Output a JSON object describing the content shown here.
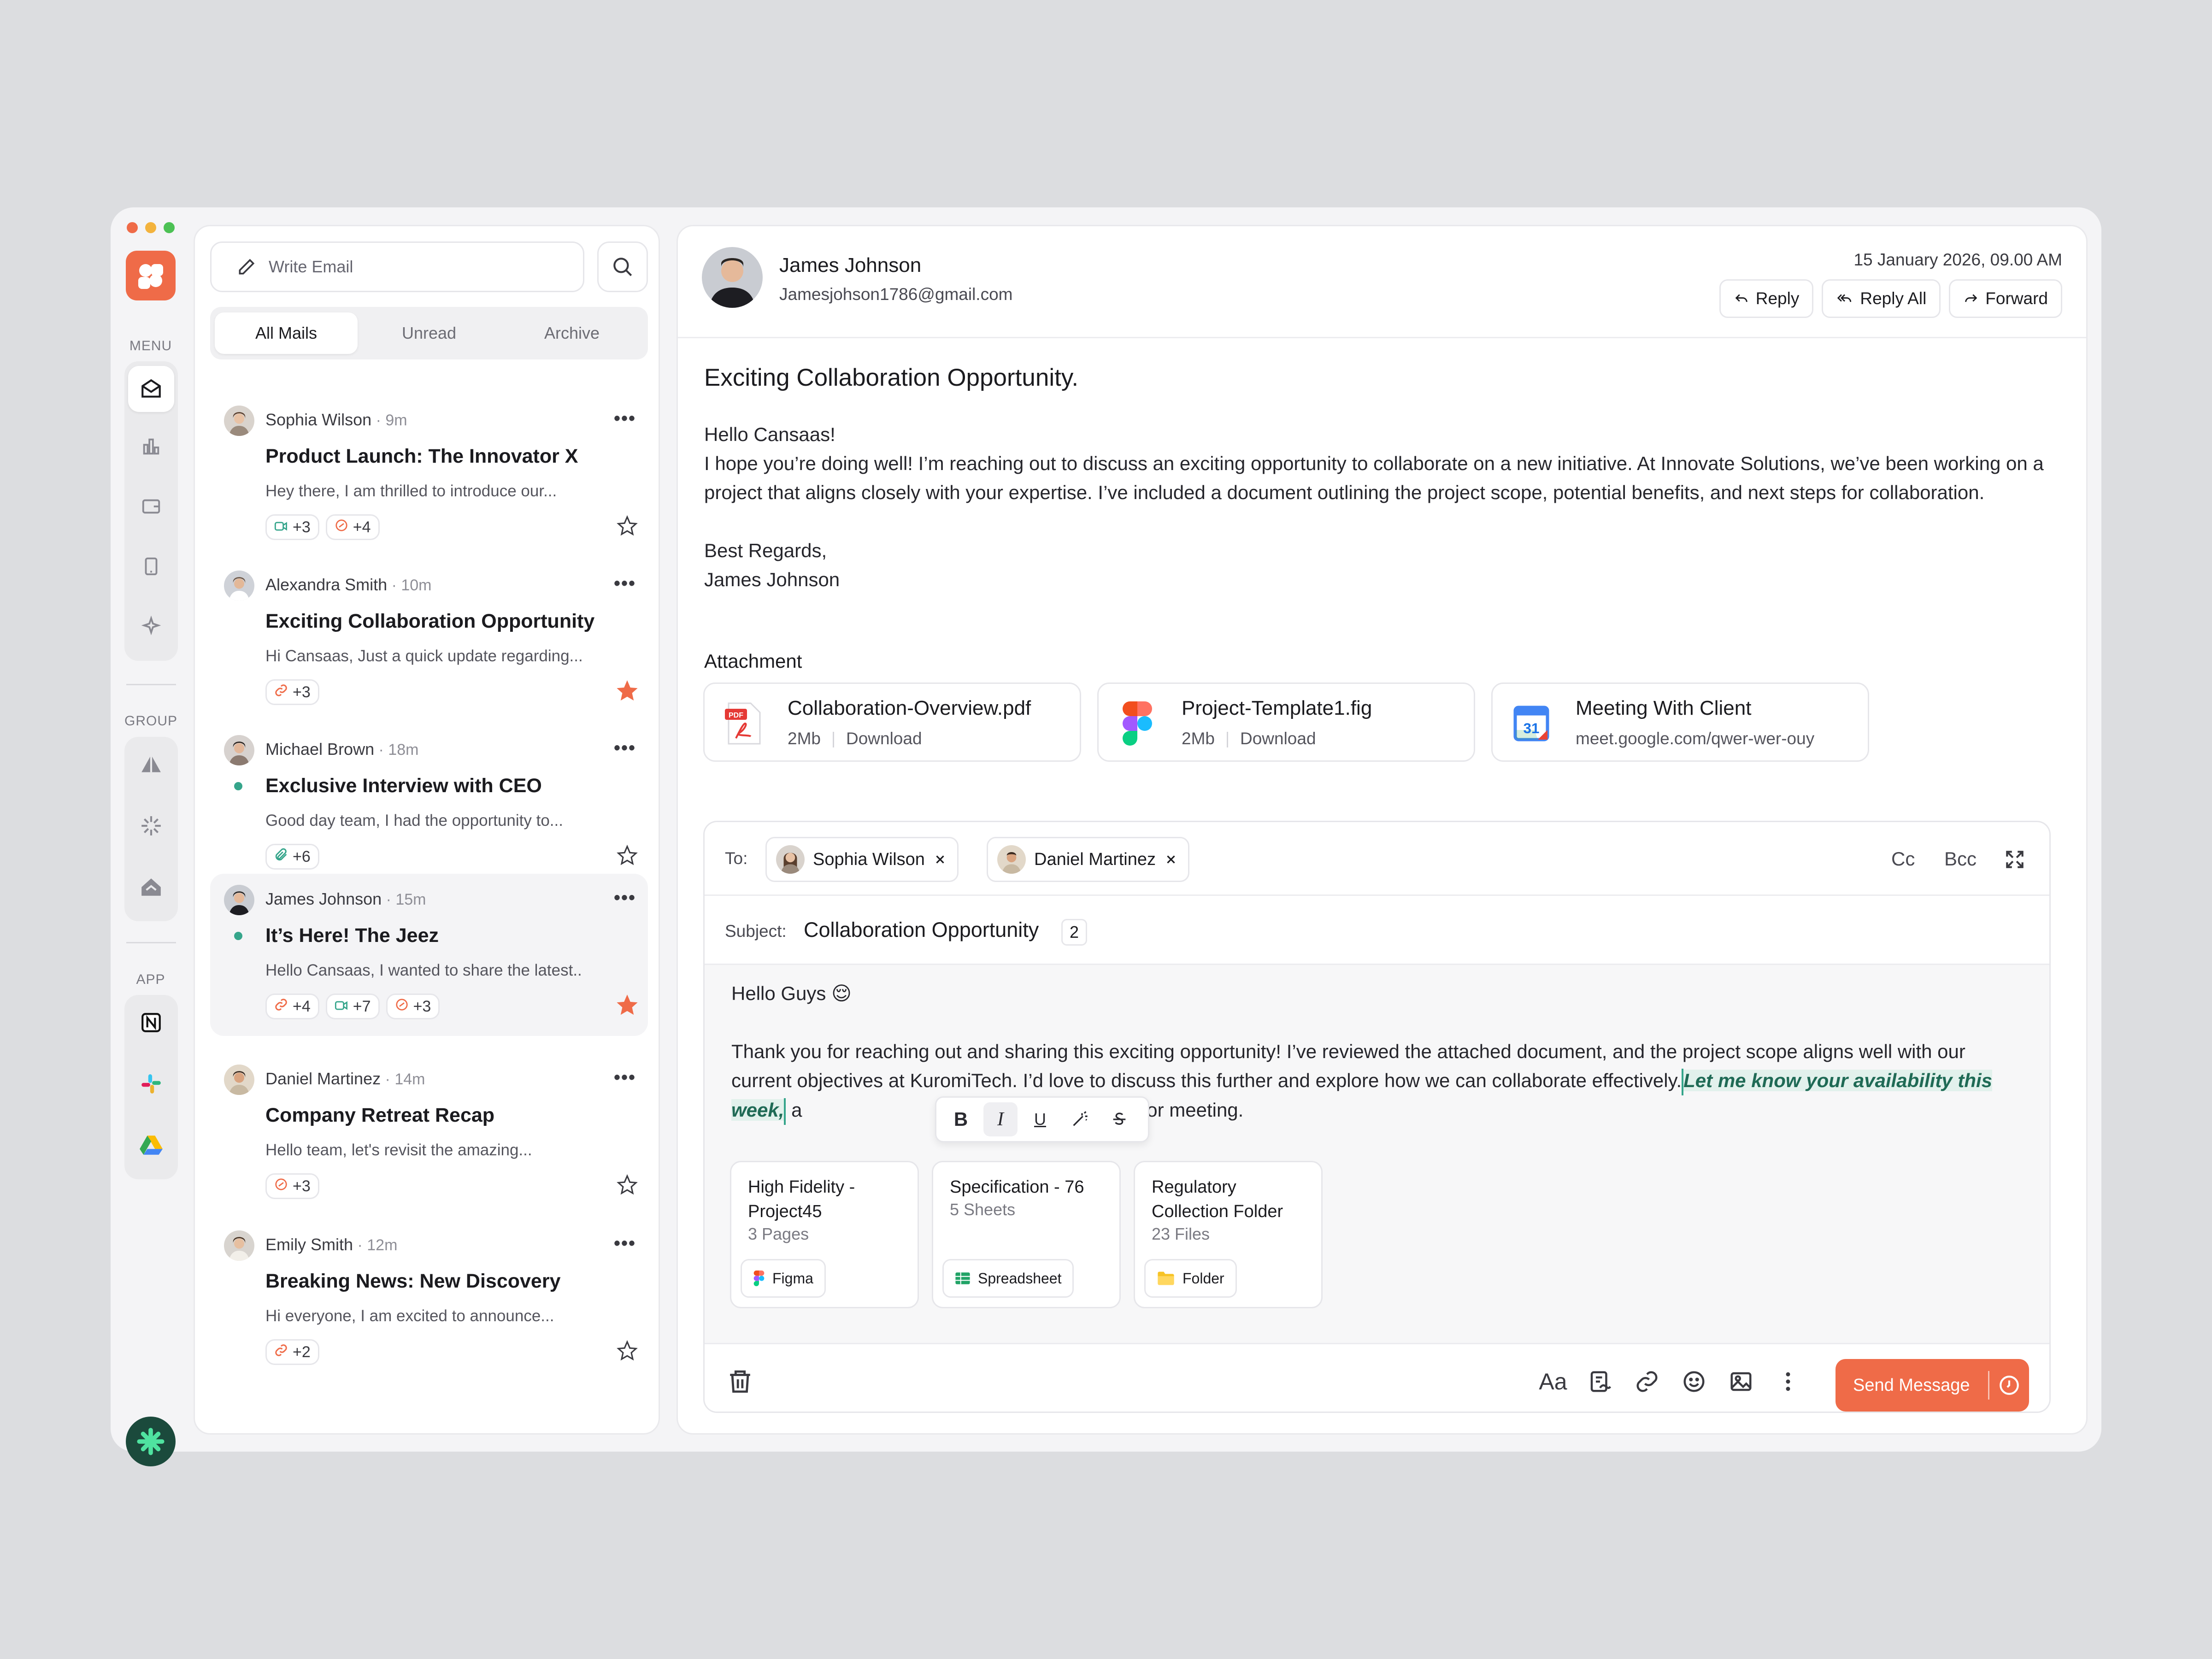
{
  "rail": {
    "menu_label": "MENU",
    "group_label": "GROUP",
    "app_label": "APP"
  },
  "mail_list": {
    "write_placeholder": "Write Email",
    "tabs": [
      "All Mails",
      "Unread",
      "Archive"
    ],
    "active_tab": "All Mails",
    "items": [
      {
        "sender": "Sophia Wilson",
        "time": " · 9m",
        "subject": "Product Launch: The Innovator X",
        "preview": "Hey there, I am thrilled to introduce our...",
        "chips": [
          {
            "icon": "video-icon",
            "count": "+3"
          },
          {
            "icon": "reaction-icon",
            "count": "+4"
          }
        ],
        "starred": false,
        "unread": false
      },
      {
        "sender": "Alexandra Smith",
        "time": " · 10m",
        "subject": "Exciting Collaboration Opportunity",
        "preview": "Hi Cansaas, Just a quick update regarding...",
        "chips": [
          {
            "icon": "link-icon",
            "count": "+3"
          }
        ],
        "starred": true,
        "unread": false
      },
      {
        "sender": "Michael Brown",
        "time": " · 18m",
        "subject": "Exclusive Interview with CEO",
        "preview": "Good day team, I had the opportunity to...",
        "chips": [
          {
            "icon": "paperclip-icon",
            "count": "+6"
          }
        ],
        "starred": false,
        "unread": true
      },
      {
        "sender": "James Johnson",
        "time": " · 15m",
        "subject": "It’s Here! The Jeez",
        "preview": "Hello Cansaas, I wanted to share the latest..",
        "chips": [
          {
            "icon": "link-icon",
            "count": "+4"
          },
          {
            "icon": "video-icon",
            "count": "+7"
          },
          {
            "icon": "reaction-icon",
            "count": "+3"
          }
        ],
        "starred": true,
        "unread": true
      },
      {
        "sender": "Daniel Martinez",
        "time": " · 14m",
        "subject": "Company Retreat Recap",
        "preview": "Hello team, let's revisit the amazing...",
        "chips": [
          {
            "icon": "reaction-icon",
            "count": "+3"
          }
        ],
        "starred": false,
        "unread": false
      },
      {
        "sender": "Emily Smith",
        "time": " · 12m",
        "subject": "Breaking News: New Discovery",
        "preview": "Hi everyone, I am excited to announce...",
        "chips": [
          {
            "icon": "link-icon",
            "count": "+2"
          }
        ],
        "starred": false,
        "unread": false
      }
    ]
  },
  "email": {
    "sender_name": "James Johnson",
    "sender_email": "Jamesjohson1786@gmail.com",
    "date": "15 January 2026, 09.00 AM",
    "actions": [
      "Reply",
      "Reply All",
      "Forward"
    ],
    "title": "Exciting Collaboration Opportunity.",
    "greeting": "Hello Cansaas!",
    "body": "I hope you’re doing well! I’m reaching out to discuss an exciting opportunity to collaborate on a new initiative. At Innovate Solutions, we’ve been working on a project that aligns closely with your expertise. I’ve included a document outlining the project scope, potential benefits, and next steps for collaboration.",
    "signoff": "Best Regards,",
    "signature": "James Johnson",
    "attachment_label": "Attachment",
    "attachments": [
      {
        "name": "Collaboration-Overview.pdf",
        "size": "2Mb",
        "action": "Download"
      },
      {
        "name": "Project-Template1.fig",
        "size": "2Mb",
        "action": "Download"
      },
      {
        "name": "Meeting With Client",
        "link": "meet.google.com/qwer-wer-ouy"
      }
    ]
  },
  "compose": {
    "to_label": "To:",
    "recipients": [
      "Sophia Wilson",
      "Daniel Martinez"
    ],
    "cc": "Cc",
    "bcc": "Bcc",
    "subject_label": "Subject:",
    "subject": "Collaboration Opportunity",
    "subject_count": "2",
    "greeting": "Hello Guys 😌",
    "text_part1": "Thank you for reaching out and sharing this exciting opportunity! I’ve reviewed the attached document, and the project scope aligns well with our current objectives at KuromiTech. I’d love to discuss this further and explore how we can collaborate effectively.",
    "text_highlight": "Let me know your availability this week,",
    "text_part2": " a",
    "text_part3": "lingly for a call or meeting.",
    "format_buttons": [
      "B",
      "I",
      "U"
    ],
    "cards": [
      {
        "title": "High Fidelity - Project45",
        "sub": "3 Pages",
        "tag": "Figma"
      },
      {
        "title": "Specification - 76",
        "sub": "5 Sheets",
        "tag": "Spreadsheet"
      },
      {
        "title": "Regulatory Collection Folder",
        "sub": "23 Files",
        "tag": "Folder"
      }
    ],
    "font_tool": "Aa",
    "send_label": "Send Message"
  },
  "colors": {
    "accent": "#ef6b48",
    "green": "#35a58b",
    "highlight": "#e2f1ec"
  }
}
